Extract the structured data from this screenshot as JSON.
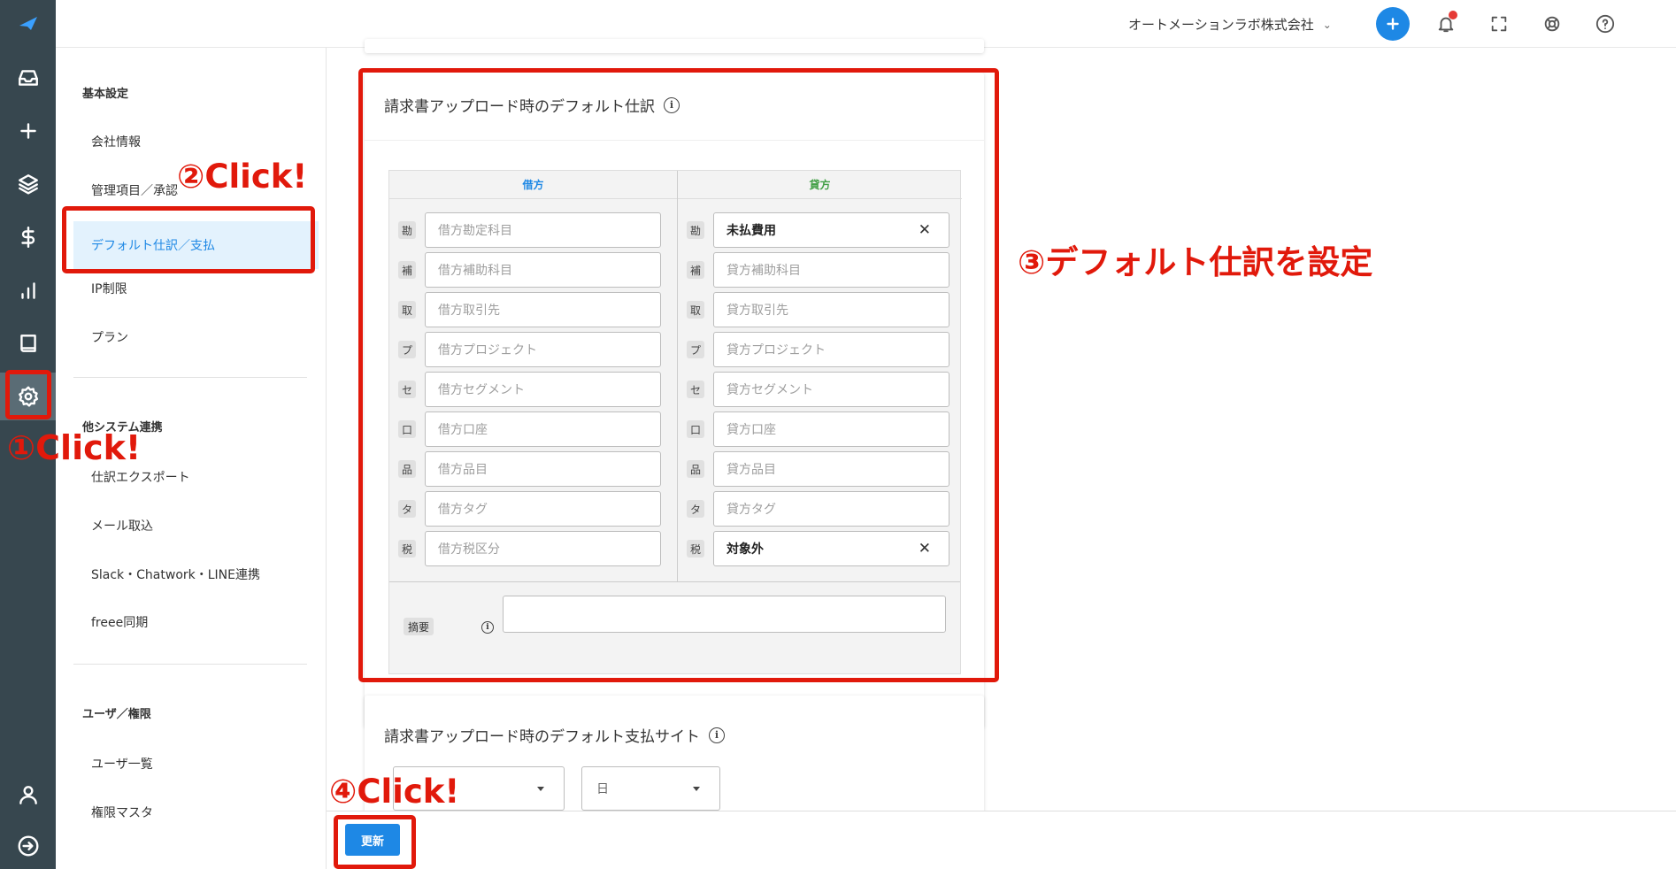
{
  "app": {
    "company_name": "オートメーションラボ株式会社"
  },
  "rail": {
    "items": [
      "logo-icon",
      "inbox-icon",
      "plus-icon",
      "layers-icon",
      "dollar-icon",
      "chart-icon",
      "book-icon",
      "gear-icon",
      "user-icon",
      "logout-icon"
    ]
  },
  "settings_nav": {
    "groups": [
      {
        "title": "基本設定",
        "items": [
          "会社情報",
          "管理項目／承認",
          "デフォルト仕訳／支払",
          "IP制限",
          "プラン"
        ]
      },
      {
        "title": "他システム連携",
        "items": [
          "仕訳エクスポート",
          "メール取込",
          "Slack・Chatwork・LINE連携",
          "freee同期"
        ]
      },
      {
        "title": "ユーザ／権限",
        "items": [
          "ユーザ一覧",
          "権限マスタ"
        ]
      }
    ],
    "active_item": "デフォルト仕訳／支払"
  },
  "journal_card": {
    "title": "請求書アップロード時のデフォルト仕訳",
    "debit_header": "借方",
    "credit_header": "貸方",
    "memo_label": "摘要",
    "memo_value": "",
    "rows": [
      {
        "chip": "勘",
        "debit_placeholder": "借方勘定科目",
        "debit_value": "",
        "credit_placeholder": "貸方勘定科目",
        "credit_value": "未払費用"
      },
      {
        "chip": "補",
        "debit_placeholder": "借方補助科目",
        "debit_value": "",
        "credit_placeholder": "貸方補助科目",
        "credit_value": ""
      },
      {
        "chip": "取",
        "debit_placeholder": "借方取引先",
        "debit_value": "",
        "credit_placeholder": "貸方取引先",
        "credit_value": ""
      },
      {
        "chip": "プ",
        "debit_placeholder": "借方プロジェクト",
        "debit_value": "",
        "credit_placeholder": "貸方プロジェクト",
        "credit_value": ""
      },
      {
        "chip": "セ",
        "debit_placeholder": "借方セグメント",
        "debit_value": "",
        "credit_placeholder": "貸方セグメント",
        "credit_value": ""
      },
      {
        "chip": "口",
        "debit_placeholder": "借方口座",
        "debit_value": "",
        "credit_placeholder": "貸方口座",
        "credit_value": ""
      },
      {
        "chip": "品",
        "debit_placeholder": "借方品目",
        "debit_value": "",
        "credit_placeholder": "貸方品目",
        "credit_value": ""
      },
      {
        "chip": "タ",
        "debit_placeholder": "借方タグ",
        "debit_value": "",
        "credit_placeholder": "貸方タグ",
        "credit_value": ""
      },
      {
        "chip": "税",
        "debit_placeholder": "借方税区分",
        "debit_value": "",
        "credit_placeholder": "貸方税区分",
        "credit_value": "対象外"
      }
    ]
  },
  "payment_card": {
    "title": "請求書アップロード時のデフォルト支払サイト",
    "month_select": "",
    "day_select": "日"
  },
  "footer": {
    "update_label": "更新"
  },
  "annotations": {
    "step1": "①Click!",
    "step2": "②Click!",
    "step3": "③デフォルト仕訳を設定",
    "step4": "④Click!",
    "color": "#e1190b"
  },
  "colors": {
    "rail_bg": "#37474f",
    "accent": "#1e88e5",
    "debit_header": "#1e88e5",
    "credit_header": "#43a047"
  }
}
